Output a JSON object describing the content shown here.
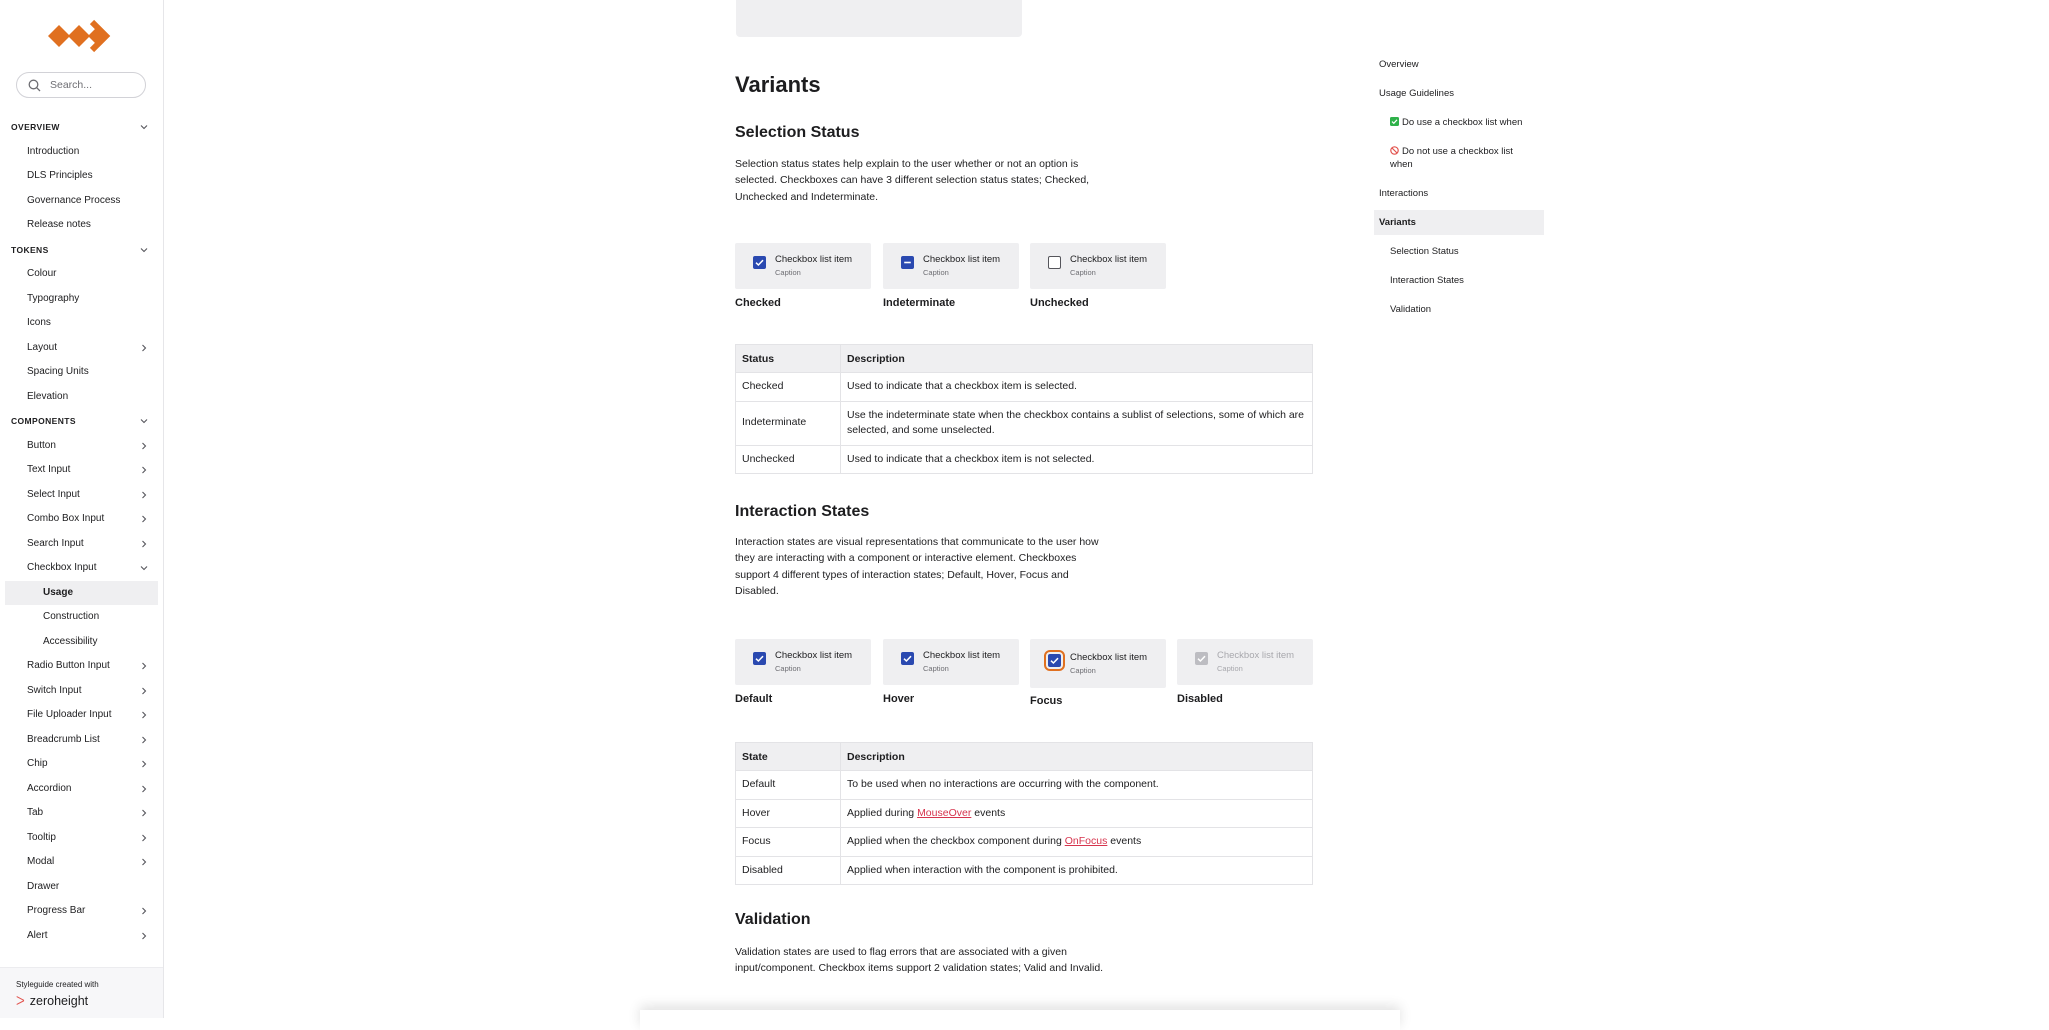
{
  "sidebar": {
    "search_placeholder": "Search...",
    "sections": [
      {
        "title": "OVERVIEW",
        "items": [
          {
            "label": "Introduction"
          },
          {
            "label": "DLS Principles"
          },
          {
            "label": "Governance Process"
          },
          {
            "label": "Release notes"
          }
        ]
      },
      {
        "title": "TOKENS",
        "items": [
          {
            "label": "Colour"
          },
          {
            "label": "Typography"
          },
          {
            "label": "Icons"
          },
          {
            "label": "Layout"
          },
          {
            "label": "Spacing Units"
          },
          {
            "label": "Elevation"
          }
        ]
      },
      {
        "title": "COMPONENTS",
        "items": [
          {
            "label": "Button"
          },
          {
            "label": "Text Input"
          },
          {
            "label": "Select Input"
          },
          {
            "label": "Combo Box Input"
          },
          {
            "label": "Search Input"
          },
          {
            "label": "Checkbox Input"
          },
          {
            "label": "Usage"
          },
          {
            "label": "Construction"
          },
          {
            "label": "Accessibility"
          },
          {
            "label": "Radio Button Input"
          },
          {
            "label": "Switch Input"
          },
          {
            "label": "File Uploader Input"
          },
          {
            "label": "Breadcrumb List"
          },
          {
            "label": "Chip"
          },
          {
            "label": "Accordion"
          },
          {
            "label": "Tab"
          },
          {
            "label": "Tooltip"
          },
          {
            "label": "Modal"
          },
          {
            "label": "Drawer"
          },
          {
            "label": "Progress Bar"
          },
          {
            "label": "Alert"
          }
        ]
      }
    ],
    "footer_label": "Styleguide created with",
    "footer_brand": "zeroheight"
  },
  "content": {
    "page_title": "Variants",
    "selection": {
      "heading": "Selection Status",
      "body": "Selection status states help explain to the user whether or not an option is selected. Checkboxes can have 3 different selection status states; Checked, Unchecked and Indeterminate.",
      "examples": [
        {
          "text": "Checkbox list item",
          "caption": "Caption",
          "label": "Checked"
        },
        {
          "text": "Checkbox list item",
          "caption": "Caption",
          "label": "Indeterminate"
        },
        {
          "text": "Checkbox list item",
          "caption": "Caption",
          "label": "Unchecked"
        }
      ],
      "table": {
        "headers": [
          "Status",
          "Description"
        ],
        "rows": [
          [
            "Checked",
            "Used to indicate that a checkbox item is selected."
          ],
          [
            "Indeterminate",
            "Use the indeterminate state when the checkbox contains a sublist of selections, some of which are selected, and some unselected."
          ],
          [
            "Unchecked",
            "Used to indicate that a checkbox item is not selected."
          ]
        ]
      }
    },
    "interaction": {
      "heading": "Interaction States",
      "body": "Interaction states are visual representations that communicate to the user how they are interacting with a component or interactive element. Checkboxes support 4 different types of interaction states; Default, Hover, Focus and Disabled.",
      "examples": [
        {
          "text": "Checkbox list item",
          "caption": "Caption",
          "label": "Default"
        },
        {
          "text": "Checkbox list item",
          "caption": "Caption",
          "label": "Hover"
        },
        {
          "text": "Checkbox list item",
          "caption": "Caption",
          "label": "Focus"
        },
        {
          "text": "Checkbox list item",
          "caption": "Caption",
          "label": "Disabled"
        }
      ],
      "table": {
        "headers": [
          "State",
          "Description"
        ],
        "rows": [
          {
            "state": "Default",
            "desc": "To be used when no interactions are occurring with the component."
          },
          {
            "state": "Hover",
            "pre": "Applied during ",
            "link": "MouseOver",
            "post": " events"
          },
          {
            "state": "Focus",
            "pre": "Applied when the checkbox component during ",
            "link": "OnFocus",
            "post": " events"
          },
          {
            "state": "Disabled",
            "desc": "Applied when interaction with the component is prohibited."
          }
        ]
      }
    },
    "validation": {
      "heading": "Validation",
      "body": "Validation states are used to flag errors that are associated with a given input/component. Checkbox items support 2 validation states; Valid and Invalid."
    }
  },
  "toc": {
    "items": [
      {
        "label": "Overview"
      },
      {
        "label": "Usage Guidelines"
      },
      {
        "label": "Do use a checkbox list when",
        "icon": "check-square-icon"
      },
      {
        "label": "Do not use a checkbox list when",
        "icon": "no-entry-icon"
      },
      {
        "label": "Interactions"
      },
      {
        "label": "Variants"
      },
      {
        "label": "Selection Status"
      },
      {
        "label": "Interaction States"
      },
      {
        "label": "Validation"
      }
    ]
  },
  "colors": {
    "brand": "#e07020",
    "checkbox": "#2a49b0",
    "link": "#d6344d",
    "active_bg": "#efeff1"
  }
}
